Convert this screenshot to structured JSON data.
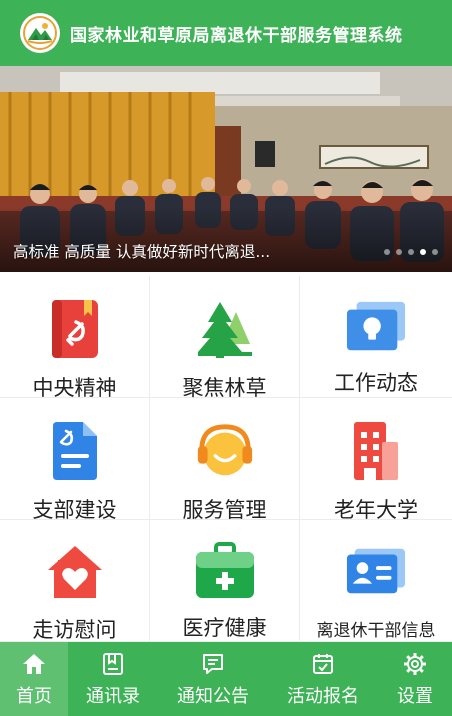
{
  "header": {
    "title": "国家林业和草原局离退休干部服务管理系统",
    "logo_icon": "forest-mountain-logo",
    "bg_color": "#3db257"
  },
  "banner": {
    "caption": "高标准 高质量 认真做好新时代离退...",
    "slide_count": 5,
    "active_slide": 4
  },
  "menu": [
    {
      "label": "中央精神",
      "icon": "party-book-icon"
    },
    {
      "label": "聚焦林草",
      "icon": "tree-icon"
    },
    {
      "label": "工作动态",
      "icon": "lightbulb-screen-icon"
    },
    {
      "label": "支部建设",
      "icon": "party-document-icon"
    },
    {
      "label": "服务管理",
      "icon": "headset-service-icon"
    },
    {
      "label": "老年大学",
      "icon": "building-icon"
    },
    {
      "label": "走访慰问",
      "icon": "heart-house-icon"
    },
    {
      "label": "医疗健康",
      "icon": "medical-kit-icon"
    },
    {
      "label": "离退休干部信息",
      "icon": "id-card-icon"
    }
  ],
  "tabbar": {
    "items": [
      {
        "label": "首页",
        "icon": "home-icon"
      },
      {
        "label": "通讯录",
        "icon": "address-book-icon"
      },
      {
        "label": "通知公告",
        "icon": "notice-icon"
      },
      {
        "label": "活动报名",
        "icon": "signup-icon"
      },
      {
        "label": "设置",
        "icon": "settings-gear-icon"
      }
    ],
    "active_index": 0
  }
}
